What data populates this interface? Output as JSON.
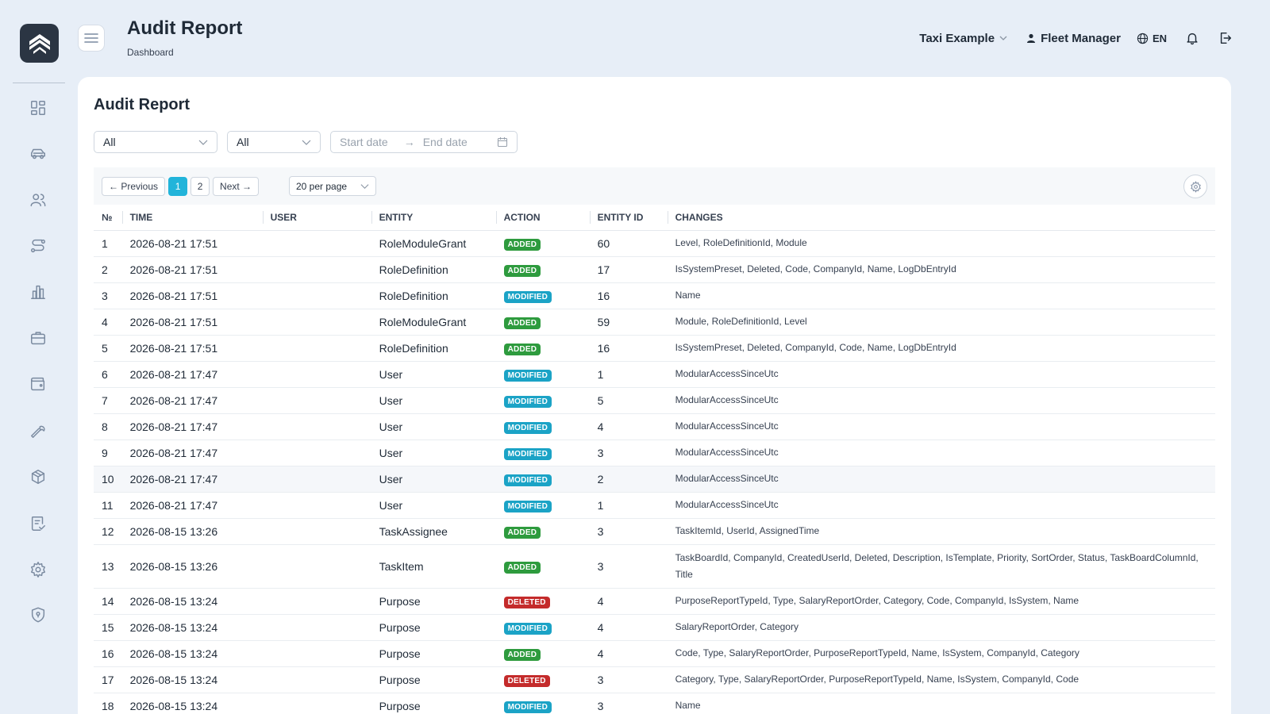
{
  "header": {
    "title": "Audit Report",
    "breadcrumb": "Dashboard",
    "company": "Taxi Example",
    "user": "Fleet Manager",
    "language": "EN"
  },
  "sidebar": {
    "items": [
      {
        "icon": "dashboard-icon"
      },
      {
        "icon": "car-icon"
      },
      {
        "icon": "users-icon"
      },
      {
        "icon": "route-icon"
      },
      {
        "icon": "chart-icon"
      },
      {
        "icon": "briefcase-icon"
      },
      {
        "icon": "wallet-icon"
      },
      {
        "icon": "wrench-icon"
      },
      {
        "icon": "package-icon"
      },
      {
        "icon": "checklist-icon"
      },
      {
        "icon": "gear-icon"
      },
      {
        "icon": "shield-icon"
      }
    ]
  },
  "report": {
    "title": "Audit Report",
    "filter_entity": "All",
    "filter_action": "All",
    "start_placeholder": "Start date",
    "end_placeholder": "End date",
    "arrow": "→"
  },
  "pagination": {
    "previous": "← Previous",
    "pages": [
      "1",
      "2"
    ],
    "current": "1",
    "next": "Next →",
    "per_page": "20 per page"
  },
  "colors": {
    "added": "#2e9b3e",
    "modified": "#1ba3c6",
    "deleted": "#c42b2b",
    "accent": "#22b4da"
  },
  "table": {
    "headers": [
      "№",
      "TIME",
      "USER",
      "ENTITY",
      "ACTION",
      "ENTITY ID",
      "CHANGES"
    ],
    "rows": [
      {
        "n": "1",
        "time": "2026-08-21 17:51",
        "user": "",
        "entity": "RoleModuleGrant",
        "action": "ADDED",
        "id": "60",
        "changes": "Level, RoleDefinitionId, Module"
      },
      {
        "n": "2",
        "time": "2026-08-21 17:51",
        "user": "",
        "entity": "RoleDefinition",
        "action": "ADDED",
        "id": "17",
        "changes": "IsSystemPreset, Deleted, Code, CompanyId, Name, LogDbEntryId"
      },
      {
        "n": "3",
        "time": "2026-08-21 17:51",
        "user": "",
        "entity": "RoleDefinition",
        "action": "MODIFIED",
        "id": "16",
        "changes": "Name"
      },
      {
        "n": "4",
        "time": "2026-08-21 17:51",
        "user": "",
        "entity": "RoleModuleGrant",
        "action": "ADDED",
        "id": "59",
        "changes": "Module, RoleDefinitionId, Level"
      },
      {
        "n": "5",
        "time": "2026-08-21 17:51",
        "user": "",
        "entity": "RoleDefinition",
        "action": "ADDED",
        "id": "16",
        "changes": "IsSystemPreset, Deleted, CompanyId, Code, Name, LogDbEntryId"
      },
      {
        "n": "6",
        "time": "2026-08-21 17:47",
        "user": "",
        "entity": "User",
        "action": "MODIFIED",
        "id": "1",
        "changes": "ModularAccessSinceUtc"
      },
      {
        "n": "7",
        "time": "2026-08-21 17:47",
        "user": "",
        "entity": "User",
        "action": "MODIFIED",
        "id": "5",
        "changes": "ModularAccessSinceUtc"
      },
      {
        "n": "8",
        "time": "2026-08-21 17:47",
        "user": "",
        "entity": "User",
        "action": "MODIFIED",
        "id": "4",
        "changes": "ModularAccessSinceUtc"
      },
      {
        "n": "9",
        "time": "2026-08-21 17:47",
        "user": "",
        "entity": "User",
        "action": "MODIFIED",
        "id": "3",
        "changes": "ModularAccessSinceUtc"
      },
      {
        "n": "10",
        "time": "2026-08-21 17:47",
        "user": "",
        "entity": "User",
        "action": "MODIFIED",
        "id": "2",
        "changes": "ModularAccessSinceUtc"
      },
      {
        "n": "11",
        "time": "2026-08-21 17:47",
        "user": "",
        "entity": "User",
        "action": "MODIFIED",
        "id": "1",
        "changes": "ModularAccessSinceUtc"
      },
      {
        "n": "12",
        "time": "2026-08-15 13:26",
        "user": "",
        "entity": "TaskAssignee",
        "action": "ADDED",
        "id": "3",
        "changes": "TaskItemId, UserId, AssignedTime"
      },
      {
        "n": "13",
        "time": "2026-08-15 13:26",
        "user": "",
        "entity": "TaskItem",
        "action": "ADDED",
        "id": "3",
        "changes": "TaskBoardId, CompanyId, CreatedUserId, Deleted, Description, IsTemplate, Priority, SortOrder, Status, TaskBoardColumnId, Title"
      },
      {
        "n": "14",
        "time": "2026-08-15 13:24",
        "user": "",
        "entity": "Purpose",
        "action": "DELETED",
        "id": "4",
        "changes": "PurposeReportTypeId, Type, SalaryReportOrder, Category, Code, CompanyId, IsSystem, Name"
      },
      {
        "n": "15",
        "time": "2026-08-15 13:24",
        "user": "",
        "entity": "Purpose",
        "action": "MODIFIED",
        "id": "4",
        "changes": "SalaryReportOrder, Category"
      },
      {
        "n": "16",
        "time": "2026-08-15 13:24",
        "user": "",
        "entity": "Purpose",
        "action": "ADDED",
        "id": "4",
        "changes": "Code, Type, SalaryReportOrder, PurposeReportTypeId, Name, IsSystem, CompanyId, Category"
      },
      {
        "n": "17",
        "time": "2026-08-15 13:24",
        "user": "",
        "entity": "Purpose",
        "action": "DELETED",
        "id": "3",
        "changes": "Category, Type, SalaryReportOrder, PurposeReportTypeId, Name, IsSystem, CompanyId, Code"
      },
      {
        "n": "18",
        "time": "2026-08-15 13:24",
        "user": "",
        "entity": "Purpose",
        "action": "MODIFIED",
        "id": "3",
        "changes": "Name"
      }
    ]
  }
}
